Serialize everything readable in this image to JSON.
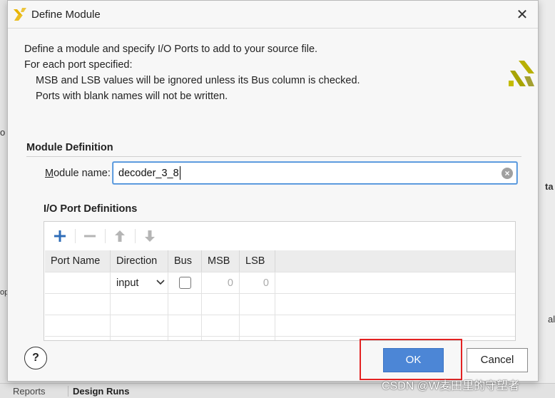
{
  "dialog": {
    "title": "Define Module",
    "close_glyph": "✕",
    "logo_icon": "xilinx-logo-icon"
  },
  "description": {
    "line1": "Define a module and specify I/O Ports to add to your source file.",
    "line2": "For each port specified:",
    "line3": "MSB and LSB values will be ignored unless its Bus column is checked.",
    "line4": "Ports with blank names will not be written."
  },
  "module_definition": {
    "section_title": "Module Definition",
    "label_first": "M",
    "label_rest": "odule name:",
    "value": "decoder_3_8"
  },
  "io_ports": {
    "section_title": "I/O Port Definitions",
    "toolbar": [
      "add-icon",
      "remove-icon",
      "move-up-icon",
      "move-down-icon"
    ],
    "columns": [
      "Port Name",
      "Direction",
      "Bus",
      "MSB",
      "LSB"
    ],
    "rows": [
      {
        "port_name": "",
        "direction": "input",
        "bus": false,
        "msb": "0",
        "lsb": "0"
      }
    ]
  },
  "buttons": {
    "help": "?",
    "ok": "OK",
    "cancel": "Cancel"
  },
  "background": {
    "left_frag_1": "o",
    "left_frag_2": "op",
    "right_frag_1": "ta",
    "right_frag_2": "al",
    "tab_reports": "Reports",
    "tab_design_runs": "Design Runs"
  },
  "watermark": "CSDN @W麦田里的守望者"
}
